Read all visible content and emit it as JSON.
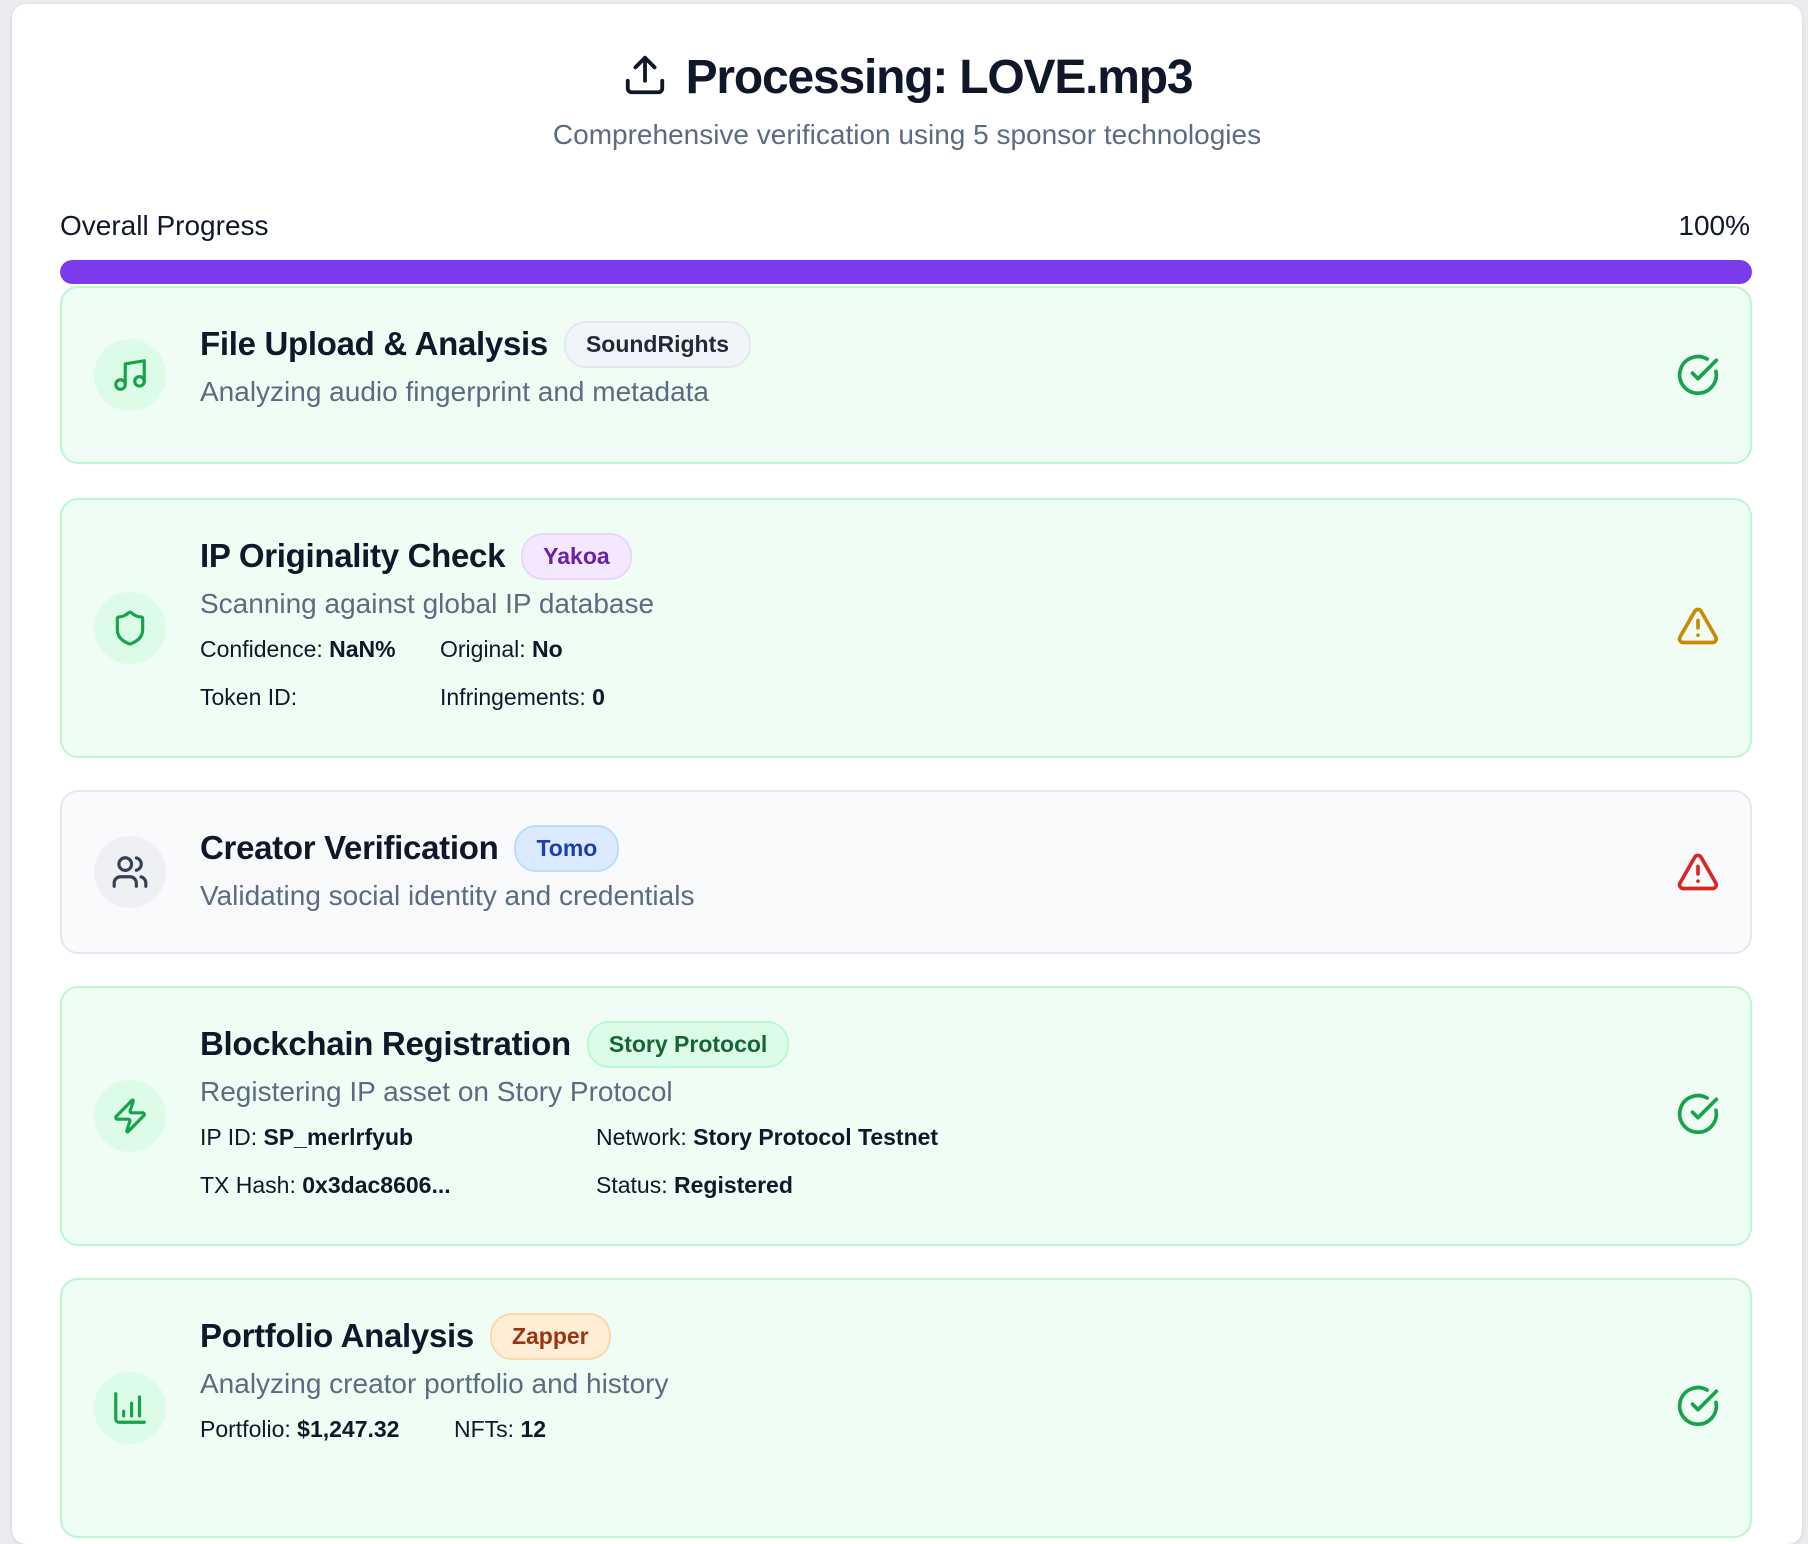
{
  "header": {
    "title": "Processing: LOVE.mp3",
    "subtitle": "Comprehensive verification using 5 sponsor technologies"
  },
  "progress": {
    "label": "Overall Progress",
    "percent_text": "100%",
    "value": 1.0,
    "color": "#7c3aed"
  },
  "steps": [
    {
      "title": "File Upload & Analysis",
      "badge": "SoundRights",
      "description": "Analyzing audio fingerprint and metadata",
      "icon": "music-icon",
      "status": "complete"
    },
    {
      "title": "IP Originality Check",
      "badge": "Yakoa",
      "description": "Scanning against global IP database",
      "icon": "shield-icon",
      "status": "warning",
      "details": {
        "confidence_label": "Confidence:",
        "confidence": "NaN%",
        "original_label": "Original:",
        "original": "No",
        "token_label": "Token ID:",
        "token": "",
        "infringements_label": "Infringements:",
        "infringements": "0"
      }
    },
    {
      "title": "Creator Verification",
      "badge": "Tomo",
      "description": "Validating social identity and credentials",
      "icon": "users-icon",
      "status": "error"
    },
    {
      "title": "Blockchain Registration",
      "badge": "Story Protocol",
      "description": "Registering IP asset on Story Protocol",
      "icon": "lightning-icon",
      "status": "complete",
      "details": {
        "ip_label": "IP ID:",
        "ip": "SP_merlrfyub",
        "network_label": "Network:",
        "network": "Story Protocol Testnet",
        "tx_label": "TX Hash:",
        "tx": "0x3dac8606...",
        "status_label": "Status:",
        "status_value": "Registered"
      }
    },
    {
      "title": "Portfolio Analysis",
      "badge": "Zapper",
      "description": "Analyzing creator portfolio and history",
      "icon": "bar-chart-icon",
      "status": "complete",
      "details": {
        "portfolio_label": "Portfolio:",
        "portfolio": "$1,247.32",
        "nfts_label": "NFTs:",
        "nfts": "12"
      }
    }
  ],
  "colors": {
    "success": "#16a34a",
    "warning": "#ca8a04",
    "error": "#dc2626"
  }
}
